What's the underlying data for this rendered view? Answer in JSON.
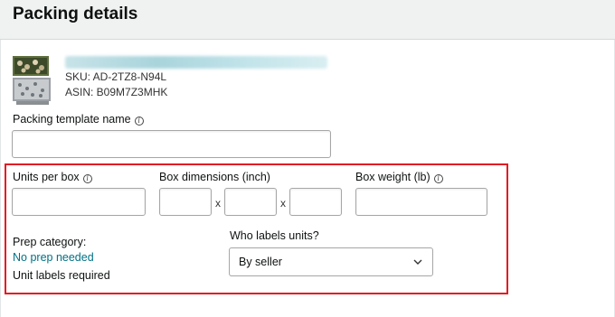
{
  "header": {
    "title": "Packing details"
  },
  "product": {
    "sku": "SKU: AD-2TZ8-N94L",
    "asin": "ASIN: B09M7Z3MHK",
    "thumbnail_icon": "product-thumbnail"
  },
  "packing_template": {
    "label": "Packing template name",
    "value": ""
  },
  "units_per_box": {
    "label": "Units per box",
    "value": ""
  },
  "box_dimensions": {
    "label": "Box dimensions (inch)",
    "separator": "x",
    "length": "",
    "width": "",
    "height": ""
  },
  "box_weight": {
    "label": "Box weight (lb)",
    "value": ""
  },
  "prep": {
    "category_label": "Prep category:",
    "category_value": "No prep needed",
    "unit_labels": "Unit labels required"
  },
  "who_labels": {
    "label": "Who labels units?",
    "selected": "By seller"
  },
  "colors": {
    "highlight": "#e21b23",
    "link": "#007185",
    "header_bg": "#f0f2f2"
  }
}
